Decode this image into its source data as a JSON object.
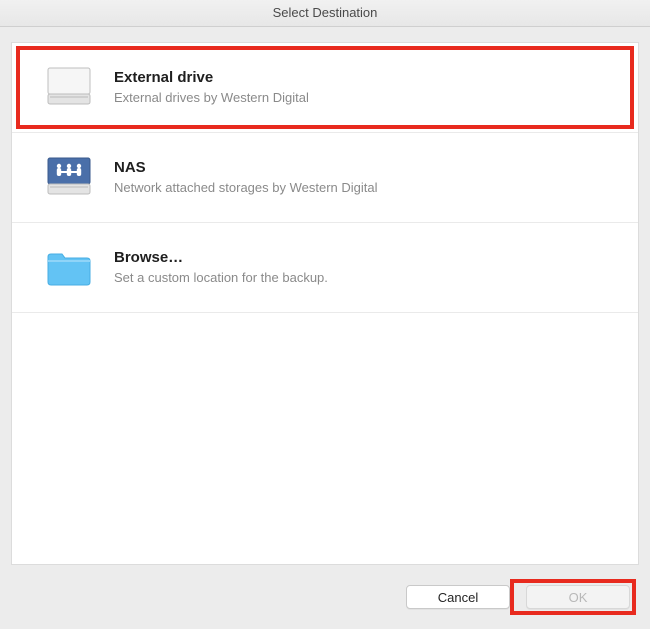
{
  "window": {
    "title": "Select Destination"
  },
  "options": [
    {
      "icon": "external-drive-icon",
      "title": "External drive",
      "subtitle": "External drives by Western Digital",
      "highlighted": true
    },
    {
      "icon": "nas-drive-icon",
      "title": "NAS",
      "subtitle": "Network attached storages by Western Digital",
      "highlighted": false
    },
    {
      "icon": "folder-icon",
      "title": "Browse…",
      "subtitle": "Set a custom location for the backup.",
      "highlighted": false
    }
  ],
  "buttons": {
    "cancel": "Cancel",
    "ok": "OK",
    "ok_highlighted": true,
    "ok_disabled": true
  }
}
